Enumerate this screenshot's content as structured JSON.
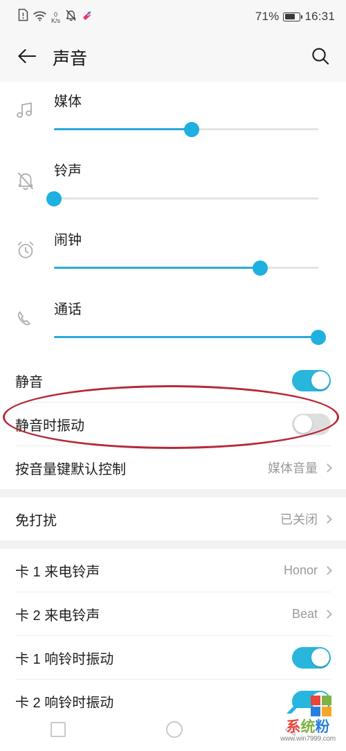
{
  "status_bar": {
    "icons": [
      "sim-alert-icon",
      "wifi-icon",
      "network-speed-icon",
      "notifications-muted-icon",
      "app-icon"
    ],
    "network_speed_value": "0",
    "network_speed_unit": "K/s",
    "battery_percent_label": "71%",
    "battery_level": 71,
    "time": "16:31"
  },
  "app_bar": {
    "back_icon": "back-arrow-icon",
    "title": "声音",
    "search_icon": "search-icon"
  },
  "sliders": [
    {
      "icon": "music-note-icon",
      "label": "媒体",
      "value": 52
    },
    {
      "icon": "bell-off-icon",
      "label": "铃声",
      "value": 0
    },
    {
      "icon": "alarm-clock-icon",
      "label": "闹钟",
      "value": 78
    },
    {
      "icon": "phone-icon",
      "label": "通话",
      "value": 100
    }
  ],
  "section_one": [
    {
      "label": "静音",
      "type": "toggle",
      "state": "on"
    },
    {
      "label": "静音时振动",
      "type": "toggle",
      "state": "off",
      "annotated": true
    },
    {
      "label": "按音量键默认控制",
      "type": "value",
      "value": "媒体音量"
    }
  ],
  "section_two": [
    {
      "label": "免打扰",
      "type": "value",
      "value": "已关闭"
    }
  ],
  "section_three": [
    {
      "label": "卡 1 来电铃声",
      "type": "value",
      "value": "Honor"
    },
    {
      "label": "卡 2 来电铃声",
      "type": "value",
      "value": "Beat"
    },
    {
      "label": "卡 1 响铃时振动",
      "type": "toggle",
      "state": "on"
    },
    {
      "label": "卡 2 响铃时振动",
      "type": "toggle",
      "state": "on"
    }
  ],
  "nav_bar": {
    "recents_icon": "square-recents-icon",
    "home_icon": "circle-home-icon",
    "back_icon": "triangle-back-icon"
  },
  "watermark": {
    "brand": "系统粉",
    "url": "www.win7999.com",
    "logo_icon": "windows-logo-icon"
  },
  "colors": {
    "accent": "#29a8dd",
    "toggle_on": "#29b6dd",
    "annotation": "#b5293a"
  }
}
